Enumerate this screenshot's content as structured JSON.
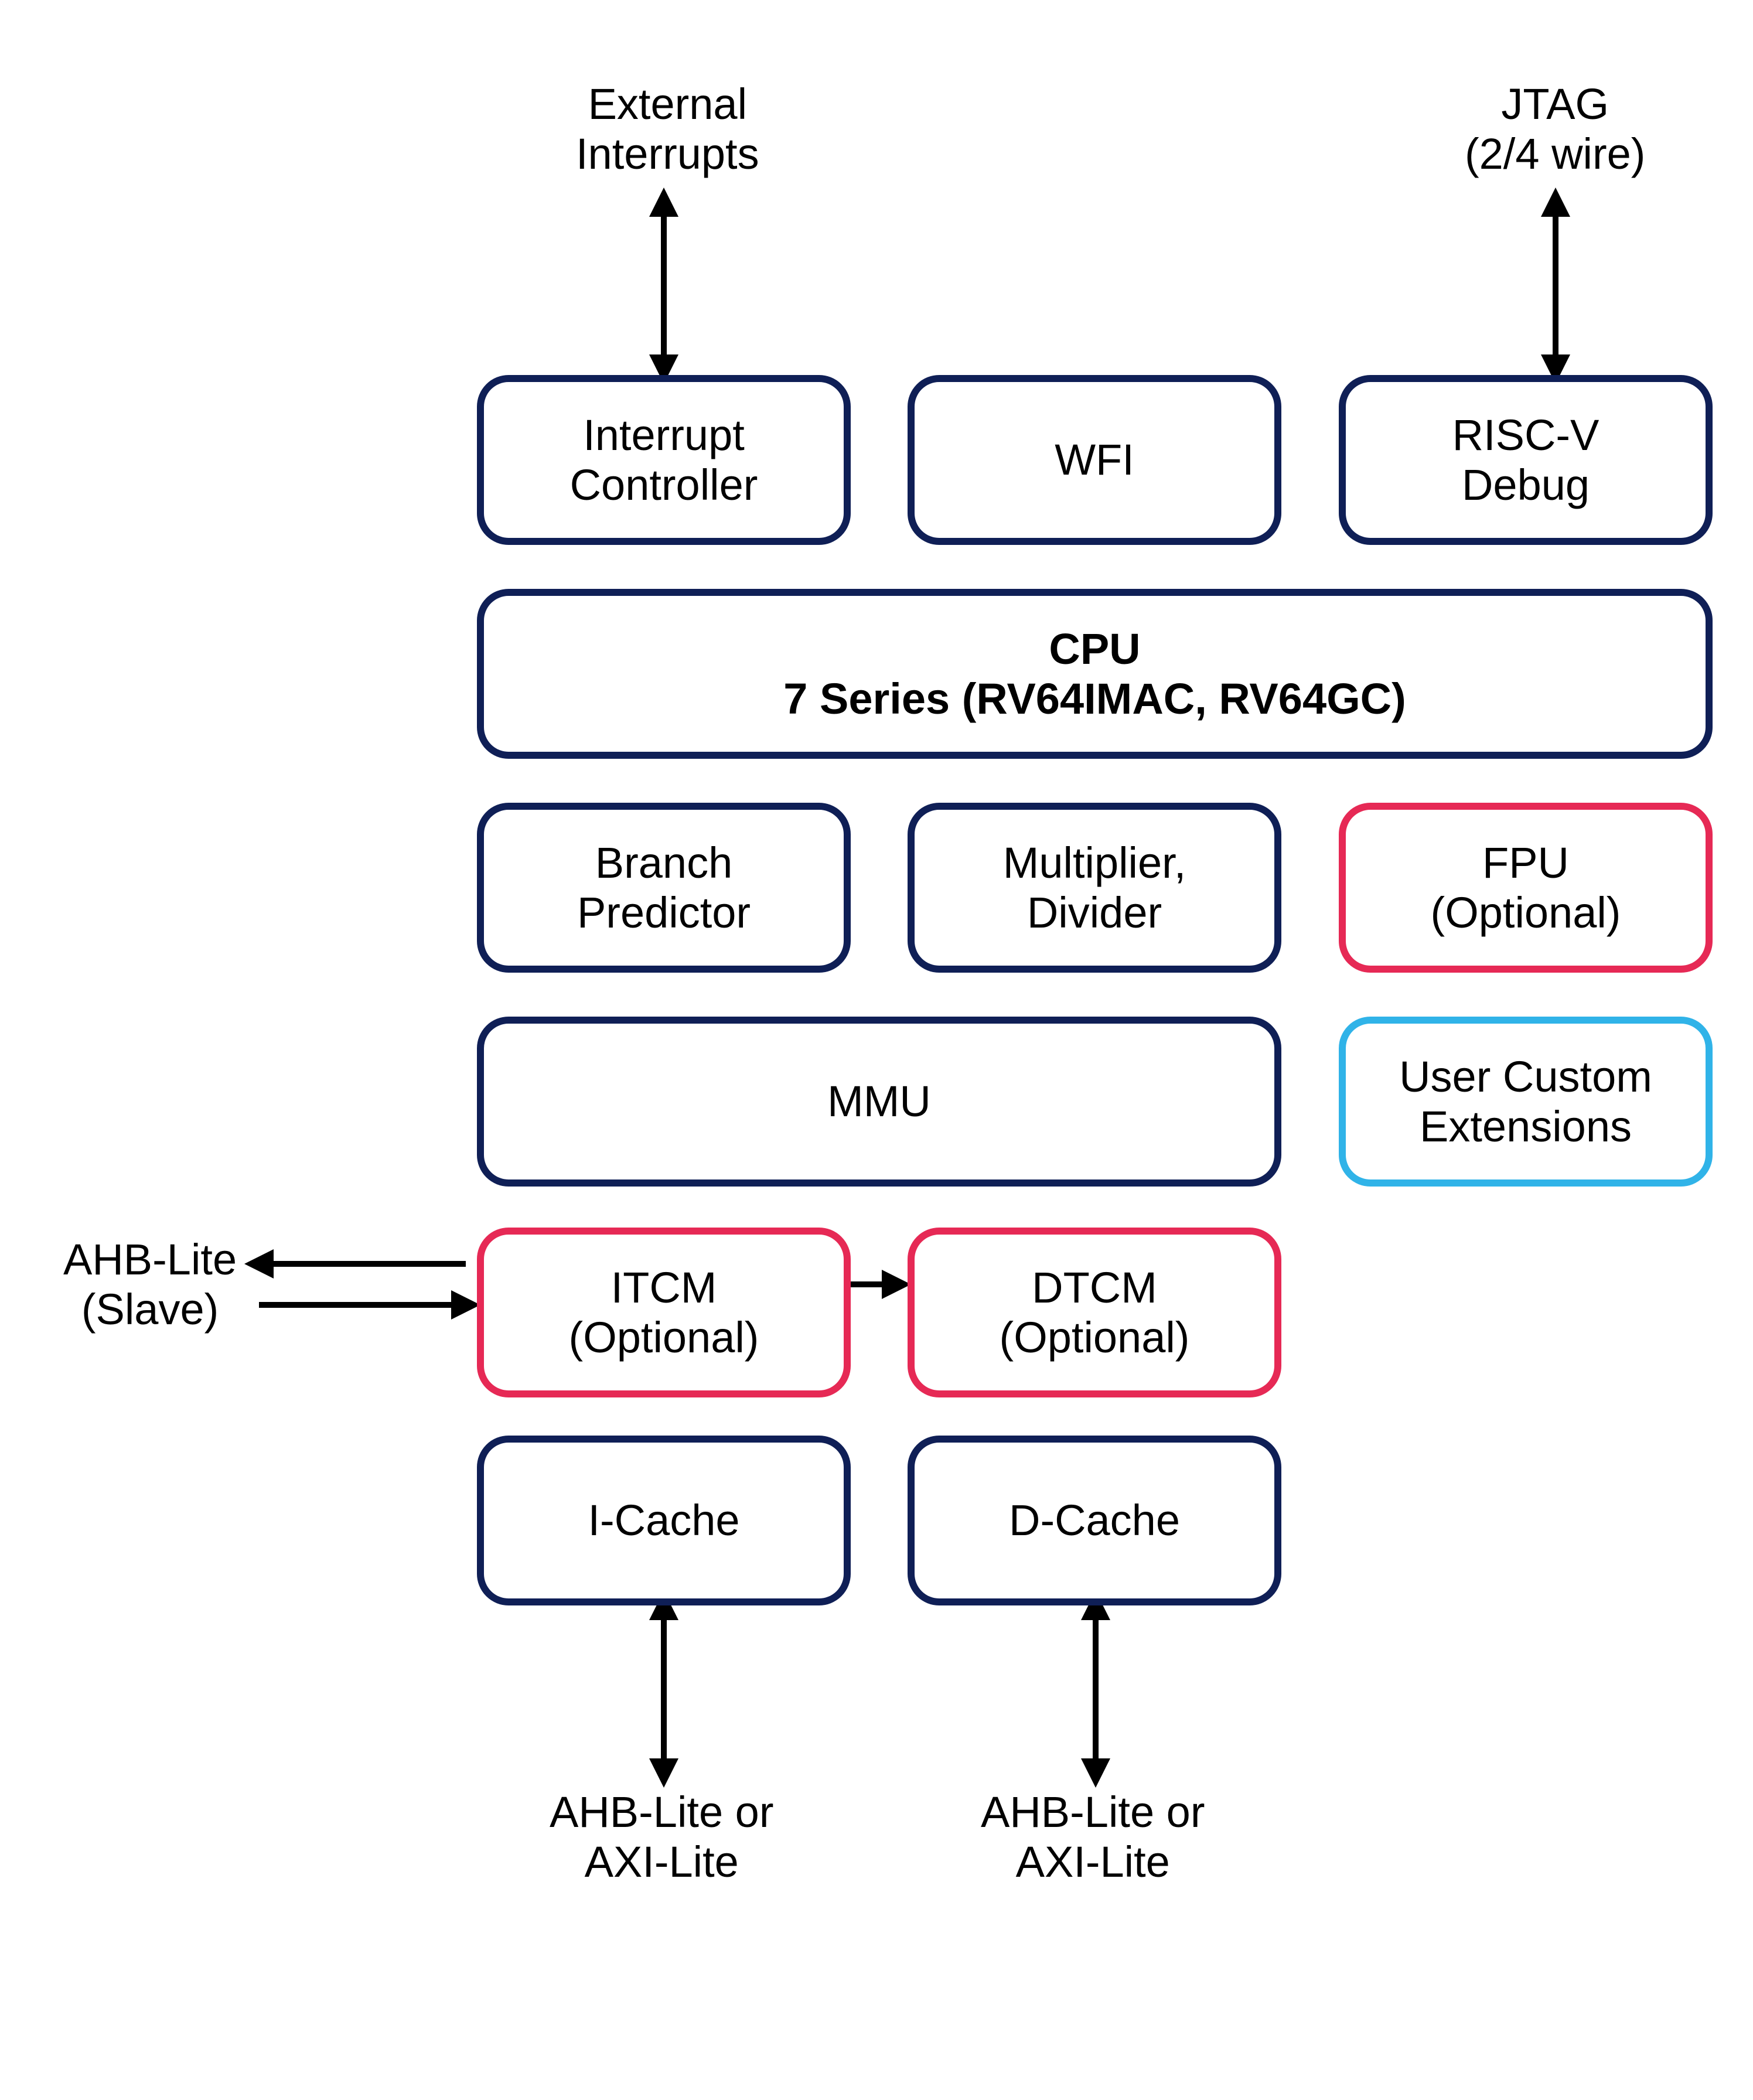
{
  "labels": {
    "ext_int_1": "External",
    "ext_int_2": "Interrupts",
    "jtag_1": "JTAG",
    "jtag_2": "(2/4 wire)",
    "ahb_slave_1": "AHB-Lite",
    "ahb_slave_2": "(Slave)",
    "bus_i_1": "AHB-Lite or",
    "bus_i_2": "AXI-Lite",
    "bus_d_1": "AHB-Lite or",
    "bus_d_2": "AXI-Lite"
  },
  "blocks": {
    "irq_1": "Interrupt",
    "irq_2": "Controller",
    "wfi": "WFI",
    "dbg_1": "RISC-V",
    "dbg_2": "Debug",
    "cpu_1": "CPU",
    "cpu_2": "7 Series (RV64IMAC, RV64GC)",
    "bp_1": "Branch",
    "bp_2": "Predictor",
    "md_1": "Multiplier,",
    "md_2": "Divider",
    "fpu_1": "FPU",
    "fpu_2": "(Optional)",
    "mmu": "MMU",
    "uce_1": "User Custom",
    "uce_2": "Extensions",
    "itcm_1": "ITCM",
    "itcm_2": "(Optional)",
    "dtcm_1": "DTCM",
    "dtcm_2": "(Optional)",
    "icache": "I-Cache",
    "dcache": "D-Cache"
  },
  "colors": {
    "navy": "#0f1f56",
    "red": "#e62955",
    "cyan": "#30b3e8"
  }
}
